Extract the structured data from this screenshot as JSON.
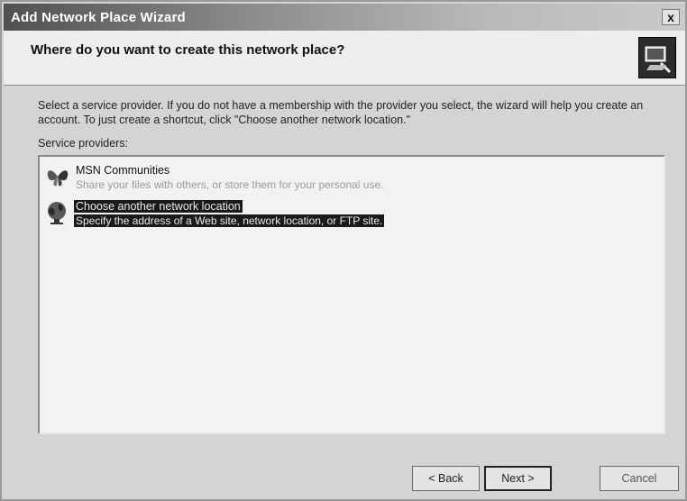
{
  "window": {
    "title": "Add Network Place Wizard",
    "close_label": "x"
  },
  "header": {
    "title": "Where do you want to create this network place?"
  },
  "body": {
    "instructions": "Select a service provider. If you do not have a membership with the provider you select, the wizard will help you create an account. To just create a shortcut, click \"Choose another network location.\"",
    "providers_label": "Service providers:"
  },
  "providers": [
    {
      "name": "MSN Communities",
      "description": "Share your files with others, or store them for your personal use.",
      "icon": "msn-butterfly-icon",
      "selected": false
    },
    {
      "name": "Choose another network location",
      "description": "Specify the address of a Web site, network location, or FTP site.",
      "icon": "network-globe-icon",
      "selected": true
    }
  ],
  "buttons": {
    "back": "< Back",
    "next": "Next >",
    "cancel": "Cancel"
  }
}
